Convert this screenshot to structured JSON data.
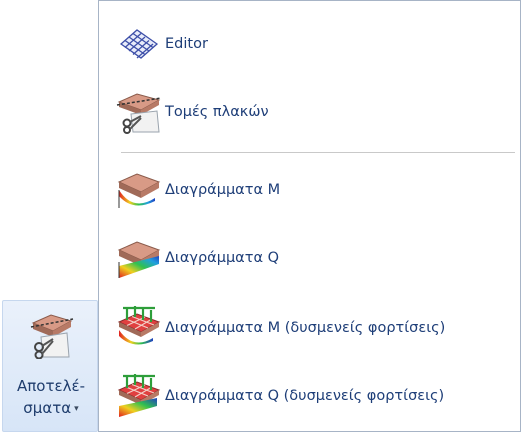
{
  "ribbon_button": {
    "label_line1": "Αποτελέ-",
    "label_line2": "σματα",
    "dropdown_glyph": "▾",
    "icon": "slab-section-scissors-icon"
  },
  "menu": {
    "items": [
      {
        "label": "Editor",
        "icon": "mesh-grid-icon"
      },
      {
        "label": "Τομές πλακών",
        "icon": "slab-section-scissors-icon"
      },
      {
        "label": "Διαγράμματα M",
        "icon": "moment-diagram-icon"
      },
      {
        "label": "Διαγράμματα Q",
        "icon": "shear-diagram-icon"
      },
      {
        "label": "Διαγράμματα M (δυσμενείς φορτίσεις)",
        "icon": "moment-unfavorable-loads-icon"
      },
      {
        "label": "Διαγράμματα Q (δυσμενείς φορτίσεις)",
        "icon": "shear-unfavorable-loads-icon"
      }
    ]
  },
  "colors": {
    "label_text": "#1e3e78",
    "ribbon_bg": "#d7e5f7",
    "menu_border": "#a7b4c6",
    "slab_top": "#d89a86",
    "load_arrows": "#2e9e3a"
  }
}
